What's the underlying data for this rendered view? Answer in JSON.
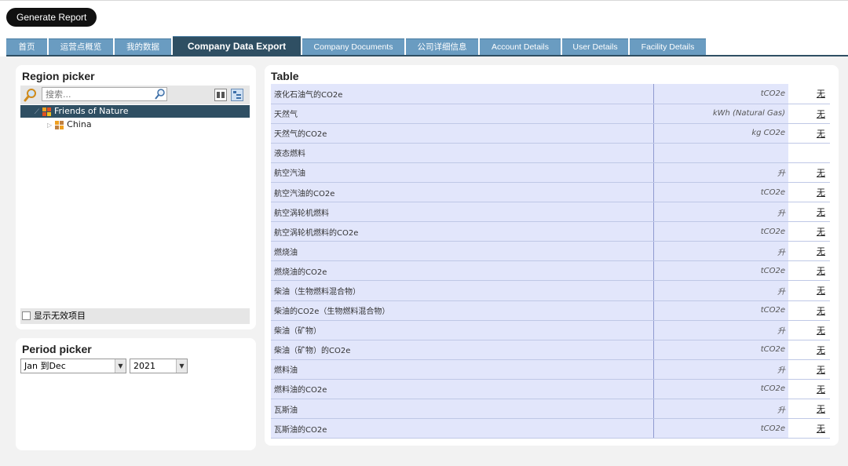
{
  "toolbar": {
    "generate_label": "Generate Report"
  },
  "tabs": [
    {
      "label": "首页"
    },
    {
      "label": "运营点概览"
    },
    {
      "label": "我的数据"
    },
    {
      "label": "Company Data Export"
    },
    {
      "label": "Company Documents"
    },
    {
      "label": "公司详细信息"
    },
    {
      "label": "Account Details"
    },
    {
      "label": "User Details"
    },
    {
      "label": "Facility Details"
    }
  ],
  "region": {
    "title": "Region picker",
    "search_placeholder": "搜索...",
    "nodes": [
      {
        "label": "Friends of Nature"
      },
      {
        "label": "China"
      }
    ],
    "show_inactive_label": "显示无效项目"
  },
  "period": {
    "title": "Period picker",
    "range_value": "Jan 到Dec",
    "year_value": "2021"
  },
  "table": {
    "title": "Table",
    "rows": [
      {
        "name": "液化石油气的CO2e",
        "unit": "tCO2e",
        "action": "无"
      },
      {
        "name": "天然气",
        "unit": "kWh (Natural Gas)",
        "action": "无"
      },
      {
        "name": "天然气的CO2e",
        "unit": "kg CO2e",
        "action": "无"
      },
      {
        "name": "液态燃料",
        "unit": "",
        "action": ""
      },
      {
        "name": "航空汽油",
        "unit": "升",
        "action": "无"
      },
      {
        "name": "航空汽油的CO2e",
        "unit": "tCO2e",
        "action": "无"
      },
      {
        "name": "航空涡轮机燃料",
        "unit": "升",
        "action": "无"
      },
      {
        "name": "航空涡轮机燃料的CO2e",
        "unit": "tCO2e",
        "action": "无"
      },
      {
        "name": "燃烧油",
        "unit": "升",
        "action": "无"
      },
      {
        "name": "燃烧油的CO2e",
        "unit": "tCO2e",
        "action": "无"
      },
      {
        "name": "柴油（生物燃料混合物）",
        "unit": "升",
        "action": "无"
      },
      {
        "name": "柴油的CO2e（生物燃料混合物）",
        "unit": "tCO2e",
        "action": "无"
      },
      {
        "name": "柴油（矿物）",
        "unit": "升",
        "action": "无"
      },
      {
        "name": "柴油（矿物）的CO2e",
        "unit": "tCO2e",
        "action": "无"
      },
      {
        "name": "燃料油",
        "unit": "升",
        "action": "无"
      },
      {
        "name": "燃料油的CO2e",
        "unit": "tCO2e",
        "action": "无"
      },
      {
        "name": "瓦斯油",
        "unit": "升",
        "action": "无"
      },
      {
        "name": "瓦斯油的CO2e",
        "unit": "tCO2e",
        "action": "无"
      }
    ]
  }
}
